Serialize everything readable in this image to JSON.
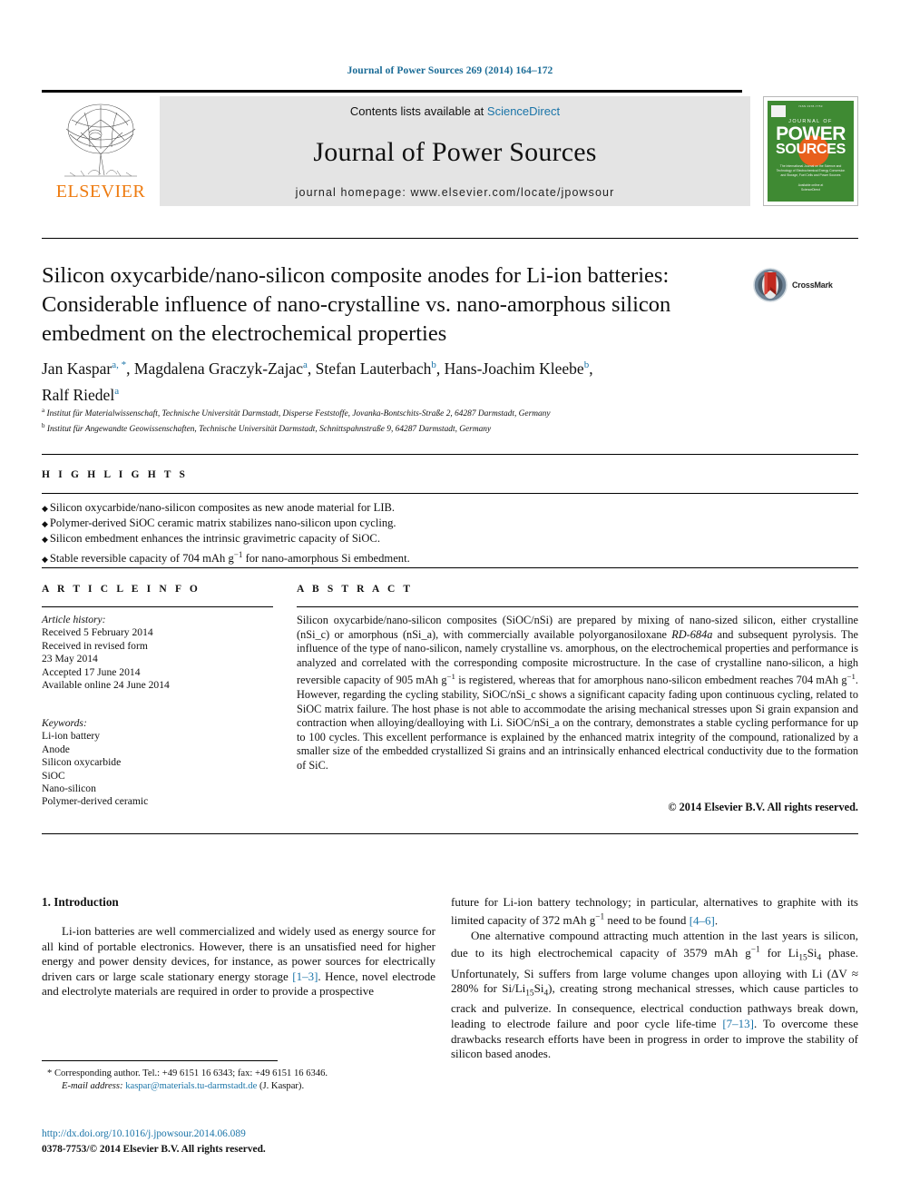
{
  "running_head": "Journal of Power Sources 269 (2014) 164–172",
  "masthead": {
    "contents_prefix": "Contents lists available at ",
    "sciencedirect": "ScienceDirect",
    "journal_name": "Journal of Power Sources",
    "homepage": "journal homepage: www.elsevier.com/locate/jpowsour",
    "publisher_word": "ELSEVIER",
    "cover": {
      "journal_of": "JOURNAL OF",
      "power": "POWER",
      "sources": "SOURCES",
      "subtitle": "The International Journal on the Science and Technology of Electro­chemical Energy Conversion and Storage, Fuel Cells and Power Sources",
      "bottom": "Available online at\nScienceDirect"
    },
    "accent_blue": "#1a74a8",
    "elsevier_orange": "#ee7b10",
    "cover_green": "#3f8a33"
  },
  "title": "Silicon oxycarbide/nano-silicon composite anodes for Li-ion batteries: Considerable influence of nano-crystalline vs. nano-amorphous silicon embedment on the electrochemical properties",
  "crossmark_label": "CrossMark",
  "authors": [
    {
      "name": "Jan Kaspar",
      "marks": "a, *"
    },
    {
      "name": "Magdalena Graczyk-Zajac",
      "marks": "a"
    },
    {
      "name": "Stefan Lauterbach",
      "marks": "b"
    },
    {
      "name": "Hans-Joachim Kleebe",
      "marks": "b"
    },
    {
      "name": "Ralf Riedel",
      "marks": "a"
    }
  ],
  "affiliations": [
    {
      "mark": "a",
      "text": "Institut für Materialwissenschaft, Technische Universität Darmstadt, Disperse Feststoffe, Jovanka-Bontschits-Straße 2, 64287 Darmstadt, Germany"
    },
    {
      "mark": "b",
      "text": "Institut für Angewandte Geowissenschaften, Technische Universität Darmstadt, Schnittspahnstraße 9, 64287 Darmstadt, Germany"
    }
  ],
  "highlights": {
    "heading": "H I G H L I G H T S",
    "items": [
      "Silicon oxycarbide/nano-silicon composites as new anode material for LIB.",
      "Polymer-derived SiOC ceramic matrix stabilizes nano-silicon upon cycling.",
      "Silicon embedment enhances the intrinsic gravimetric capacity of SiOC.",
      "Stable reversible capacity of 704 mAh g−1 for nano-amorphous Si embedment."
    ]
  },
  "article_info": {
    "heading": "A R T I C L E    I N F O",
    "history_label": "Article history:",
    "history": [
      "Received 5 February 2014",
      "Received in revised form",
      "23 May 2014",
      "Accepted 17 June 2014",
      "Available online 24 June 2014"
    ],
    "keywords_label": "Keywords:",
    "keywords": [
      "Li-ion battery",
      "Anode",
      "Silicon oxycarbide",
      "SiOC",
      "Nano-silicon",
      "Polymer-derived ceramic"
    ]
  },
  "abstract": {
    "heading": "A B S T R A C T",
    "text_part1": "Silicon oxycarbide/nano-silicon composites (SiOC/nSi) are prepared by mixing of nano-sized silicon, either crystalline (nSi_c) or amorphous (nSi_a), with commercially available polyorganosiloxane ",
    "product_italic": "RD-684a",
    "text_part2": " and subsequent pyrolysis. The influence of the type of nano-silicon, namely crystalline vs. amorphous, on the electrochemical properties and performance is analyzed and correlated with the corresponding composite microstructure. In the case of crystalline nano-silicon, a high reversible capacity of 905 mAh g−1 is registered, whereas that for amorphous nano-silicon embedment reaches 704 mAh g−1. However, regarding the cycling stability, SiOC/nSi_c shows a significant capacity fading upon continuous cycling, related to SiOC matrix failure. The host phase is not able to accommodate the arising mechanical stresses upon Si grain expansion and contraction when alloying/dealloying with Li. SiOC/nSi_a on the contrary, demonstrates a stable cycling performance for up to 100 cycles. This excellent performance is explained by the enhanced matrix integrity of the compound, rationalized by a smaller size of the embedded crystallized Si grains and an intrinsically enhanced electrical conductivity due to the formation of SiC.",
    "copyright": "© 2014 Elsevier B.V. All rights reserved."
  },
  "body": {
    "section_number_title": "1.  Introduction",
    "left_paragraph": "Li-ion batteries are well commercialized and widely used as energy source for all kind of portable electronics. However, there is an unsatisfied need for higher energy and power density devices, for instance, as power sources for electrically driven cars or large scale stationary energy storage ",
    "left_ref": "[1–3]",
    "left_paragraph_cont": ". Hence, novel electrode and electrolyte materials are required in order to provide a prospective",
    "right_p1_a": "future for Li-ion battery technology; in particular, alternatives to graphite with its limited capacity of 372 mAh g−1 need to be found ",
    "right_p1_ref": "[4–6]",
    "right_p1_b": ".",
    "right_p2_a": "One alternative compound attracting much attention in the last years is silicon, due to its high electrochemical capacity of 3579 mAh g−1 for Li15Si4 phase. Unfortunately, Si suffers from large volume changes upon alloying with Li (ΔV ≈ 280% for Si/Li15Si4), creating strong mechanical stresses, which cause particles to crack and pulverize. In consequence, electrical conduction pathways break down, leading to electrode failure and poor cycle life-time ",
    "right_p2_ref": "[7–13]",
    "right_p2_b": ". To overcome these drawbacks research efforts have been in progress in order to improve the stability of silicon based anodes."
  },
  "footer": {
    "corresponding": "* Corresponding author. Tel.: +49 6151 16 6343; fax: +49 6151 16 6346.",
    "email_label": "E-mail address:",
    "email": "kaspar@materials.tu-darmstadt.de",
    "email_suffix": "(J. Kaspar).",
    "doi": "http://dx.doi.org/10.1016/j.jpowsour.2014.06.089",
    "issn": "0378-7753/© 2014 Elsevier B.V. All rights reserved."
  }
}
